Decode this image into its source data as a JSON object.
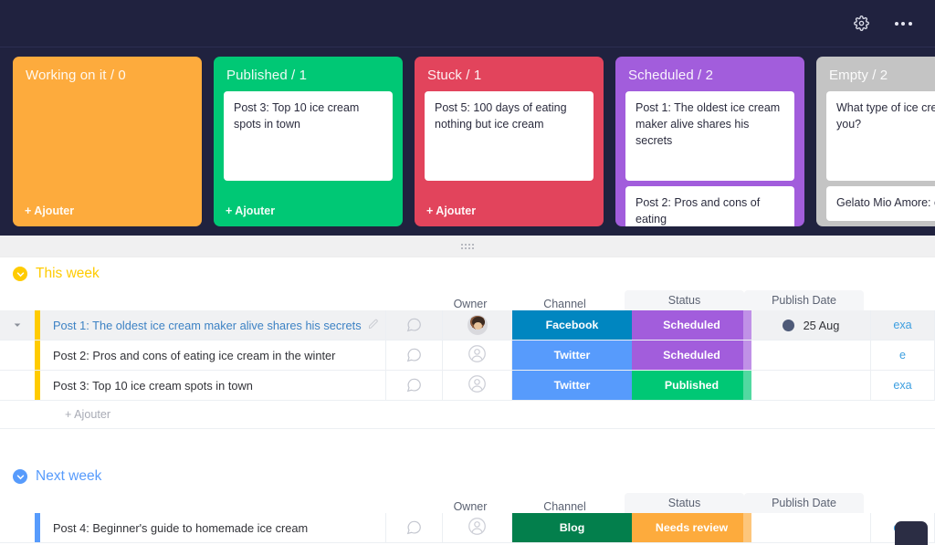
{
  "topbar": {
    "settings_icon": "gear-icon",
    "menu_icon": "ellipsis-icon"
  },
  "board": {
    "add_label": "+ Ajouter",
    "columns": [
      {
        "title": "Working on it / 0",
        "color": "#FDAB3D",
        "cards": []
      },
      {
        "title": "Published / 1",
        "color": "#00C875",
        "cards": [
          {
            "text": "Post 3: Top 10 ice cream spots in town"
          }
        ]
      },
      {
        "title": "Stuck / 1",
        "color": "#E2445C",
        "cards": [
          {
            "text": "Post 5: 100 days of eating nothing but ice cream"
          }
        ]
      },
      {
        "title": "Scheduled / 2",
        "color": "#A25DDC",
        "cards": [
          {
            "text": "Post 1: The oldest ice cream maker alive shares his secrets"
          },
          {
            "text": "Post 2: Pros and cons of eating"
          }
        ]
      },
      {
        "title": "Empty / 2",
        "color": "#C4C4C4",
        "cards": [
          {
            "text": "What type of ice cream are you?"
          },
          {
            "text": "Gelato Mio Amore: epic su"
          }
        ]
      }
    ]
  },
  "table": {
    "headers": {
      "owner": "Owner",
      "channel": "Channel",
      "status": "Status",
      "date": "Publish Date"
    },
    "add_row_label": "+ Ajouter",
    "groups": [
      {
        "title": "This week",
        "color": "#FFCB00",
        "rows": [
          {
            "name": "Post 1: The oldest ice cream maker alive shares his secrets",
            "selected": true,
            "has_pencil": true,
            "owner_avatar": "photo",
            "channel": "Facebook",
            "channel_color": "#0086C0",
            "status": "Scheduled",
            "status_color": "#A25DDC",
            "date": "25 Aug",
            "date_dot": true,
            "link": "exa"
          },
          {
            "name": "Post 2: Pros and cons of eating ice cream in the winter",
            "selected": false,
            "has_pencil": false,
            "owner_avatar": "placeholder",
            "channel": "Twitter",
            "channel_color": "#579BFC",
            "status": "Scheduled",
            "status_color": "#A25DDC",
            "date": "",
            "date_dot": false,
            "link": "e"
          },
          {
            "name": "Post 3: Top 10 ice cream spots in town",
            "selected": false,
            "has_pencil": false,
            "owner_avatar": "placeholder",
            "channel": "Twitter",
            "channel_color": "#579BFC",
            "status": "Published",
            "status_color": "#00C875",
            "date": "",
            "date_dot": false,
            "link": "exa"
          }
        ]
      },
      {
        "title": "Next week",
        "color": "#579BFC",
        "rows": [
          {
            "name": "Post 4: Beginner's guide to homemade ice cream",
            "selected": false,
            "has_pencil": false,
            "owner_avatar": "placeholder",
            "channel": "Blog",
            "channel_color": "#037F4C",
            "status": "Needs review",
            "status_color": "#FDAB3D",
            "date": "",
            "date_dot": false,
            "link": "exa"
          }
        ]
      }
    ]
  }
}
